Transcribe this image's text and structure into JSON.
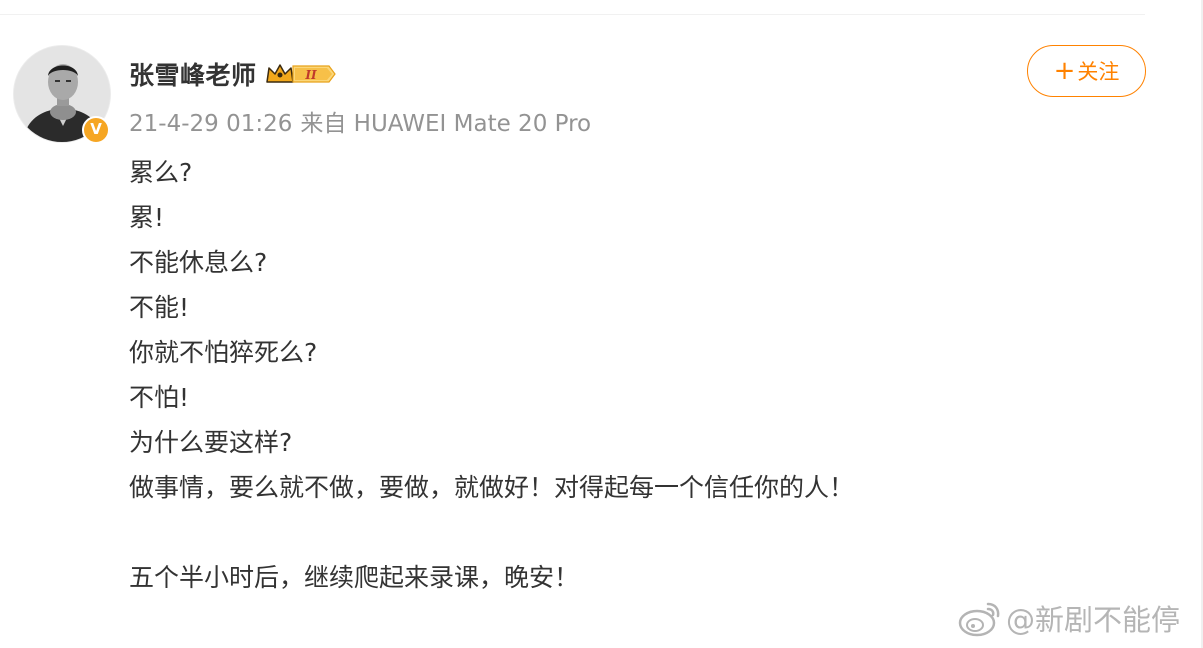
{
  "post": {
    "author": {
      "name": "张雪峰老师",
      "verified_mark": "V",
      "vip_level": "II"
    },
    "timestamp": "21-4-29 01:26",
    "source": "来自 HUAWEI Mate 20 Pro",
    "follow_label": "关注",
    "follow_plus": "+",
    "lines": [
      "累么?",
      "累!",
      "不能休息么?",
      "不能!",
      "你就不怕猝死么?",
      "不怕!",
      "为什么要这样?",
      "做事情，要么就不做，要做，就做好！对得起每一个信任你的人！",
      "",
      "五个半小时后，继续爬起来录课，晚安！"
    ]
  },
  "watermark": {
    "text": "@新剧不能停",
    "icon": "weibo-logo-icon"
  },
  "colors": {
    "accent": "#ff8200",
    "meta_gray": "#939393",
    "text": "#333333",
    "verified_badge": "#f6a623"
  }
}
